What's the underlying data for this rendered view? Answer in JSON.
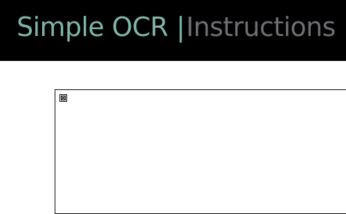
{
  "header": {
    "app_title": "Simple OCR",
    "separator": "|",
    "section_title": "Instructions",
    "colors": {
      "background": "#000000",
      "app_title": "#7fb6a8",
      "section_title": "#6e6e74"
    }
  },
  "content": {
    "placeholder_icon": "broken-image-icon"
  }
}
